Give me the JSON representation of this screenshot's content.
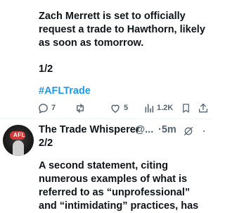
{
  "tweet": {
    "text_lines": [
      "Zach Merrett is set to officially",
      "request a trade to Hawthorn, likely",
      "as soon as tomorrow."
    ],
    "thread_count": "1/2",
    "hashtag": "#AFLTrade",
    "actions": {
      "replies": "7",
      "reposts": "",
      "likes": "5",
      "views": "1.2K"
    }
  },
  "reply": {
    "author_name": "The Trade Whisperer",
    "handle": "@...",
    "separator": "·",
    "timestamp": "5m",
    "thread_count": "2/2",
    "text_lines": [
      "A second statement, citing",
      "numerous examples of what is",
      "referred to as “unprofessional”",
      "and “intimidating” practices, has"
    ],
    "avatar_badge": "AFL"
  },
  "colors": {
    "text": "#0f1419",
    "secondary": "#536471",
    "link": "#1d9bf0",
    "divider": "#eff3f4"
  },
  "icons": [
    "reply-icon",
    "repost-icon",
    "like-icon",
    "views-icon",
    "bookmark-icon",
    "share-icon",
    "grok-icon",
    "more-icon"
  ]
}
